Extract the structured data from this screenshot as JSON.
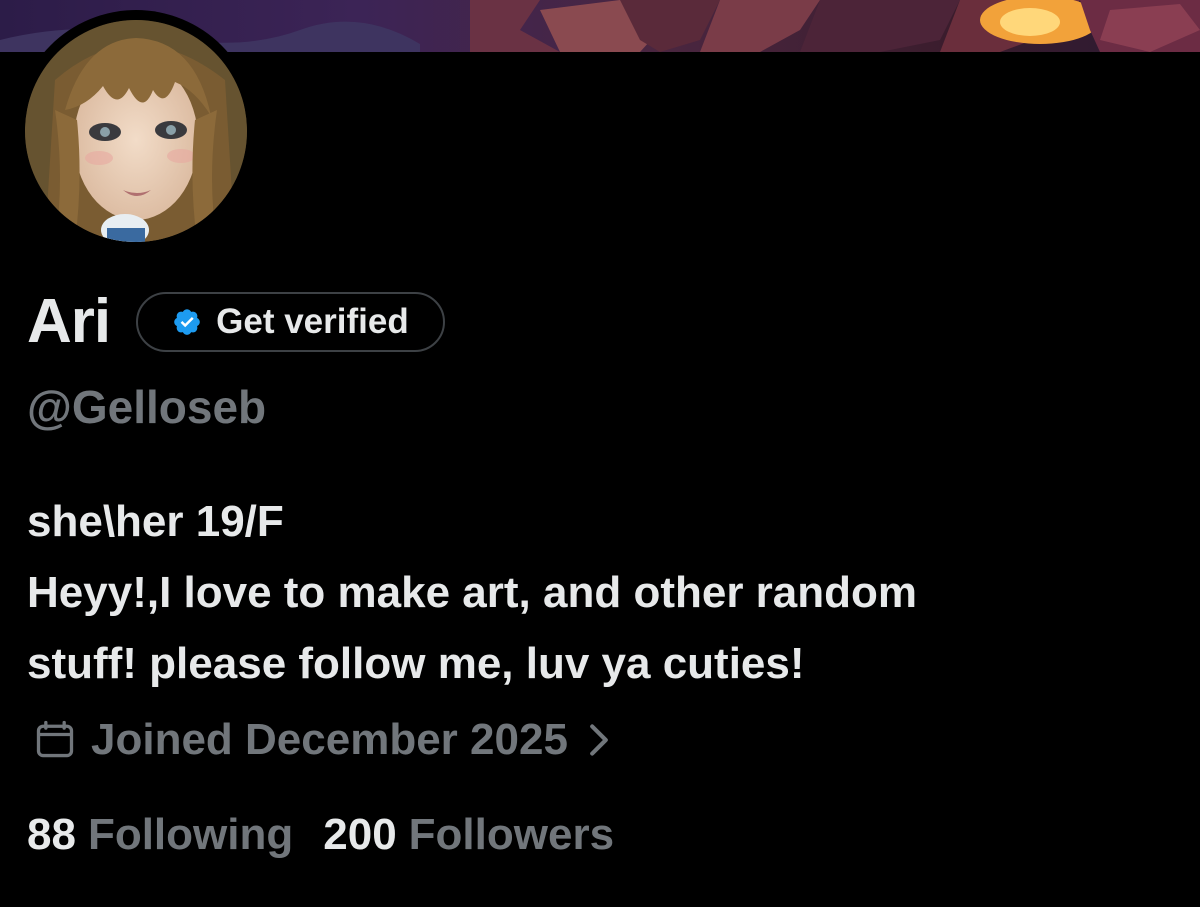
{
  "profile": {
    "display_name": "Ari",
    "verify_button_label": "Get verified",
    "handle": "@Gelloseb",
    "bio_lines": [
      "she\\her 19/F",
      "Heyy!,I love to make art, and other random",
      "stuff! please follow me, luv ya cuties!"
    ],
    "joined": "Joined December 2025"
  },
  "stats": {
    "following_count": "88",
    "following_label": "Following",
    "followers_count": "200",
    "followers_label": "Followers"
  },
  "icons": {
    "verified": "verified-badge-icon",
    "calendar": "calendar-icon",
    "chevron": "chevron-right-icon"
  },
  "colors": {
    "background": "#000000",
    "primary_text": "#e7e9ea",
    "secondary_text": "#71767b",
    "verified_blue": "#1d9bf0",
    "pill_border": "#3d4145"
  }
}
